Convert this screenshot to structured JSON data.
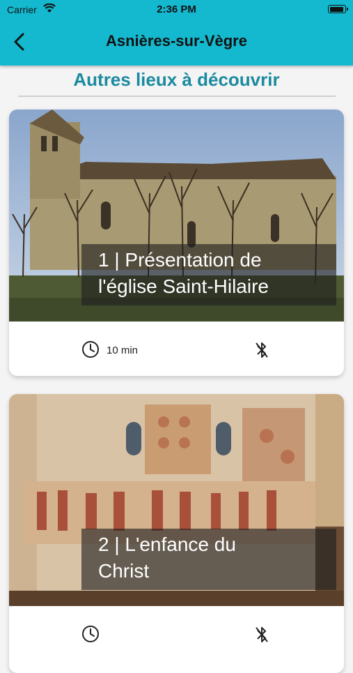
{
  "status_bar": {
    "carrier": "Carrier",
    "time": "2:36 PM"
  },
  "header": {
    "title": "Asnières-sur-Vègre",
    "back_icon": "chevron-left-icon"
  },
  "section": {
    "title": "Autres lieux à découvrir"
  },
  "cards": [
    {
      "caption_line1": "1 | Présentation de",
      "caption_line2": "l'église Saint-Hilaire",
      "duration": "10 min",
      "duration_icon": "clock-icon",
      "status_icon": "bluetooth-off-icon"
    },
    {
      "caption_line1": "2 | L'enfance du",
      "caption_line2": "Christ",
      "status_icon": "bluetooth-off-icon"
    }
  ],
  "colors": {
    "header": "#14b9cf",
    "accent": "#1b8aa0",
    "background": "#f4f4f4"
  }
}
